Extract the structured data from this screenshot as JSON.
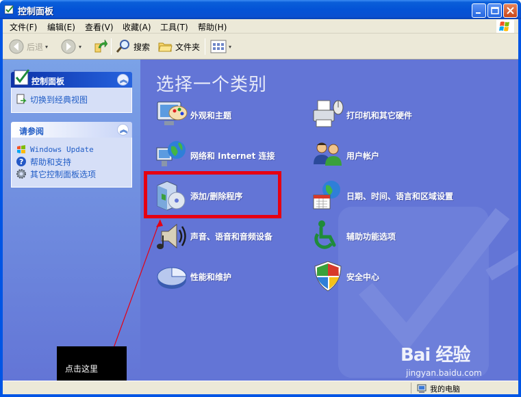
{
  "window": {
    "title": "控制面板"
  },
  "menu": [
    "文件(F)",
    "编辑(E)",
    "查看(V)",
    "收藏(A)",
    "工具(T)",
    "帮助(H)"
  ],
  "toolbar": {
    "back": "后退",
    "search": "搜索",
    "folders": "文件夹"
  },
  "sidebar": {
    "control_panel": {
      "title": "控制面板",
      "link": "切换到经典视图"
    },
    "see_also": {
      "title": "请参阅",
      "links": [
        "Windows Update",
        "帮助和支持",
        "其它控制面板选项"
      ]
    }
  },
  "main": {
    "heading": "选择一个类别",
    "categories": [
      "外观和主题",
      "打印机和其它硬件",
      "网络和 Internet 连接",
      "用户帐户",
      "添加/删除程序",
      "日期、时间、语言和区域设置",
      "声音、语音和音频设备",
      "辅助功能选项",
      "性能和维护",
      "安全中心"
    ]
  },
  "status": {
    "computer": "我的电脑"
  },
  "annotation": {
    "text": "点击这里"
  },
  "watermark": {
    "logo": "Bai 经验",
    "url": "jingyan.baidu.com"
  },
  "colors": {
    "client_bg": "#6375d6",
    "highlight": "#e60012",
    "titlebar": "#0453d6"
  }
}
